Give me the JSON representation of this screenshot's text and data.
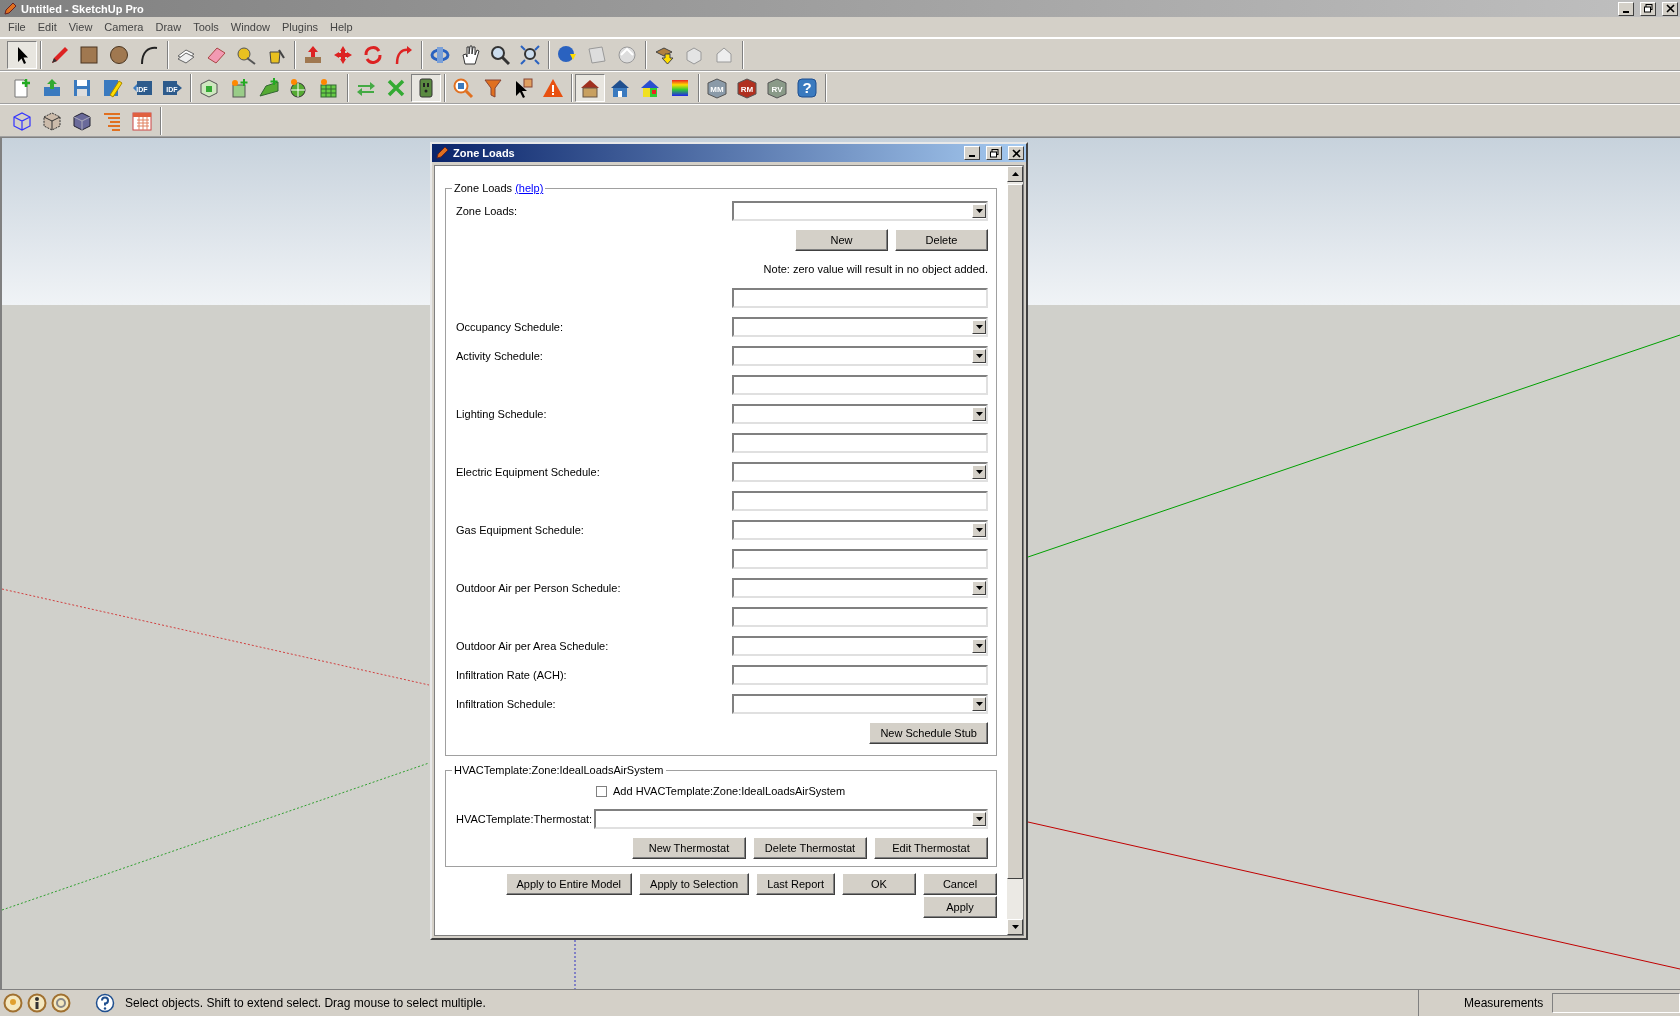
{
  "window": {
    "title": "Untitled - SketchUp Pro"
  },
  "menu": [
    "File",
    "Edit",
    "View",
    "Camera",
    "Draw",
    "Tools",
    "Window",
    "Plugins",
    "Help"
  ],
  "toolbars": [
    {
      "groups": [
        [
          {
            "pressed": true
          }
        ],
        [
          {
            "pressed": false
          },
          {
            "pressed": false
          },
          {
            "pressed": false
          },
          {
            "pressed": false
          }
        ],
        [
          {
            "pressed": false
          },
          {
            "pressed": false
          },
          {
            "pressed": false
          },
          {
            "pressed": false
          }
        ],
        [
          {
            "pressed": false
          },
          {
            "pressed": false
          },
          {
            "pressed": false
          },
          {
            "pressed": false
          }
        ],
        [
          {
            "pressed": false
          },
          {
            "pressed": false
          },
          {
            "pressed": false
          },
          {
            "pressed": false
          }
        ],
        [
          {
            "pressed": false
          },
          {
            "pressed": false
          },
          {
            "pressed": false
          }
        ],
        [
          {
            "pressed": false
          },
          {
            "pressed": false
          },
          {
            "pressed": false
          }
        ]
      ]
    },
    {
      "groups": [
        [
          {
            "pressed": false
          },
          {
            "pressed": false
          },
          {
            "pressed": false
          },
          {
            "pressed": false
          },
          {
            "pressed": false,
            "label": "IDF"
          },
          {
            "pressed": false,
            "label": "IDF"
          }
        ],
        [
          {
            "pressed": false
          },
          {
            "pressed": false
          },
          {
            "pressed": false
          },
          {
            "pressed": false
          },
          {
            "pressed": false
          }
        ],
        [
          {
            "pressed": false
          },
          {
            "pressed": false
          },
          {
            "pressed": true
          }
        ],
        [
          {
            "pressed": false
          },
          {
            "pressed": false
          },
          {
            "pressed": false
          },
          {
            "pressed": false
          }
        ],
        [
          {
            "pressed": true
          },
          {
            "pressed": false
          },
          {
            "pressed": false
          },
          {
            "pressed": false
          }
        ],
        [
          {
            "pressed": false,
            "label": "MM"
          },
          {
            "pressed": false,
            "label": "RM"
          },
          {
            "pressed": false,
            "label": "RV"
          },
          {
            "pressed": false,
            "label": "?"
          }
        ]
      ]
    },
    {
      "groups": [
        [
          {
            "pressed": false
          },
          {
            "pressed": false
          },
          {
            "pressed": false
          },
          {
            "pressed": false
          },
          {
            "pressed": false
          }
        ]
      ]
    }
  ],
  "dialog": {
    "title": "Zone Loads",
    "zone_loads_group": {
      "title": "Zone Loads",
      "help_link": "(help)",
      "rows": [
        {
          "kind": "combo",
          "label": "Zone Loads:"
        },
        {
          "kind": "buttons",
          "buttons": [
            "New",
            "Delete"
          ]
        },
        {
          "kind": "note",
          "text": "Note: zero value will result in no object added."
        },
        {
          "kind": "text"
        },
        {
          "kind": "combo",
          "label": "Occupancy Schedule:"
        },
        {
          "kind": "combo",
          "label": "Activity Schedule:"
        },
        {
          "kind": "text"
        },
        {
          "kind": "combo",
          "label": "Lighting Schedule:"
        },
        {
          "kind": "text"
        },
        {
          "kind": "combo",
          "label": "Electric Equipment Schedule:"
        },
        {
          "kind": "text"
        },
        {
          "kind": "combo",
          "label": "Gas Equipment Schedule:"
        },
        {
          "kind": "text"
        },
        {
          "kind": "combo",
          "label": "Outdoor Air per Person Schedule:"
        },
        {
          "kind": "text"
        },
        {
          "kind": "combo",
          "label": "Outdoor Air per Area Schedule:"
        },
        {
          "kind": "text",
          "label": "Infiltration Rate (ACH):"
        },
        {
          "kind": "combo",
          "label": "Infiltration Schedule:"
        },
        {
          "kind": "stub",
          "buttons": [
            "New Schedule Stub"
          ]
        }
      ]
    },
    "hvac_group": {
      "title": "HVACTemplate:Zone:IdealLoadsAirSystem",
      "checkbox": {
        "label": "Add HVACTemplate:Zone:IdealLoadsAirSystem",
        "checked": false
      },
      "thermostat_label": "HVACTemplate:Thermostat:",
      "buttons": [
        "New Thermostat",
        "Delete Thermostat",
        "Edit Thermostat"
      ]
    },
    "buttons": [
      "Apply to Entire Model",
      "Apply to Selection",
      "Last Report",
      "OK",
      "Cancel"
    ],
    "buttons_row_2": [
      "Apply"
    ]
  },
  "status_bar": {
    "message": "Select objects. Shift to extend select. Drag mouse to select multiple.",
    "measurements_label": "Measurements"
  }
}
